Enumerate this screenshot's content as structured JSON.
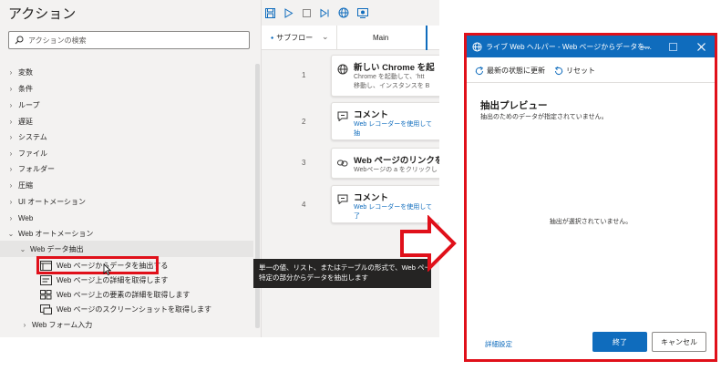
{
  "actions_panel": {
    "title": "アクション",
    "search_placeholder": "アクションの検索",
    "categories": [
      {
        "label": "変数"
      },
      {
        "label": "条件"
      },
      {
        "label": "ループ"
      },
      {
        "label": "遅延"
      },
      {
        "label": "システム"
      },
      {
        "label": "ファイル"
      },
      {
        "label": "フォルダー"
      },
      {
        "label": "圧縮"
      },
      {
        "label": "UI オートメーション"
      },
      {
        "label": "Web"
      },
      {
        "label": "Web オートメーション"
      },
      {
        "label": "Web データ抽出"
      },
      {
        "label": "Web フォーム入力"
      }
    ],
    "web_data_actions": [
      {
        "label": "Web ページからデータを抽出する"
      },
      {
        "label": "Web ページ上の詳細を取得します"
      },
      {
        "label": "Web ページ上の要素の詳細を取得します"
      },
      {
        "label": "Web ページのスクリーンショットを取得します"
      }
    ]
  },
  "designer": {
    "subflow_label": "サブフロー",
    "main_tab": "Main",
    "steps": [
      {
        "number": "1",
        "title": "新しい Chrome を起",
        "line1": "Chrome を起動して、'htt",
        "line2": "移動し、インスタンスを B"
      },
      {
        "number": "2",
        "title": "コメント",
        "line1": "Web レコーダーを使用して",
        "line2": "抽"
      },
      {
        "number": "3",
        "title": "Web ページのリンクを",
        "line1": "Webページの a をクリックし",
        "line2": ""
      },
      {
        "number": "4",
        "title": "コメント",
        "line1": "Web レコーダーを使用して",
        "line2": "了"
      }
    ]
  },
  "tooltip": {
    "line1": "単一の値、リスト、またはテーブルの形式で、Web ページの",
    "line2": "特定の部分からデータを抽出します"
  },
  "helper_window": {
    "title": "ライブ Web ヘルパー - Web ページからデータを…",
    "refresh_label": "最新の状態に更新",
    "reset_label": "リセット",
    "preview_heading": "抽出プレビュー",
    "preview_subtitle": "抽出のためのデータが指定されていません。",
    "empty_message": "抽出が選択されていません。",
    "advanced_link": "詳細設定",
    "finish_label": "終了",
    "cancel_label": "キャンセル"
  },
  "colors": {
    "accent": "#0f6cbd",
    "highlight": "#e0101a"
  }
}
